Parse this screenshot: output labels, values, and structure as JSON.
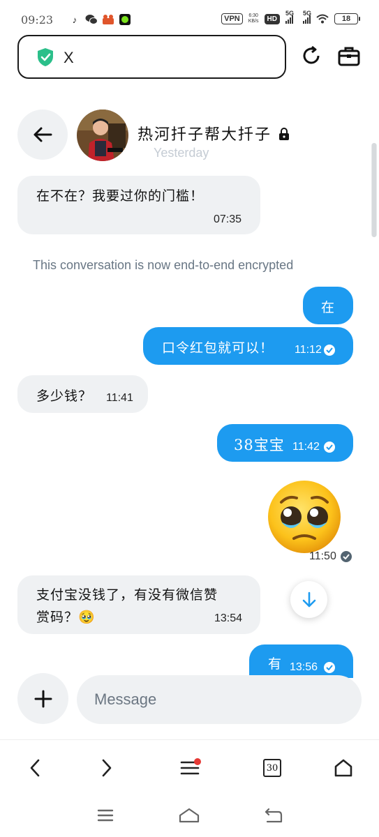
{
  "status": {
    "time": "09:23",
    "vpn": "VPN",
    "net_speed_value": "6:30",
    "net_speed_unit": "KB/s",
    "hd": "HD",
    "sig1": "5G",
    "sig2": "5G",
    "battery": "18"
  },
  "browser": {
    "url": "X",
    "tab_count": "30"
  },
  "chat": {
    "name": "热河扦子帮大扦子",
    "date_label": "Yesterday",
    "encryption_note": "This conversation is now end-to-end encrypted",
    "messages": [
      {
        "dir": "in",
        "text": "在不在？我要过你的门槛！",
        "time": "07:35"
      },
      {
        "dir": "out",
        "text": "在",
        "time": ""
      },
      {
        "dir": "out",
        "text": "口令红包就可以！",
        "time": "11:12"
      },
      {
        "dir": "in",
        "text": "多少钱？",
        "time": "11:41"
      },
      {
        "dir": "out",
        "text": "38宝宝",
        "time": "11:42"
      },
      {
        "dir": "out",
        "text": "🥹",
        "time": "11:50"
      },
      {
        "dir": "in",
        "text_line1": "支付宝没钱了，有没有微信赞",
        "text_line2": "赏码？🥹",
        "time": "13:54"
      },
      {
        "dir": "out",
        "text": "有",
        "time": "13:56"
      }
    ]
  },
  "composer": {
    "placeholder": "Message"
  },
  "colors": {
    "accent": "#1d9bf0",
    "bubble_in": "#eff1f3",
    "muted_text": "#687684",
    "notification_dot": "#e53935"
  },
  "icons": {
    "shield": "shield-check-icon",
    "refresh": "refresh-icon",
    "toolbox": "toolbox-icon",
    "back": "arrow-left-icon",
    "lock": "lock-icon",
    "check": "check-circle-icon",
    "scroll_down": "arrow-down-icon",
    "add": "plus-icon"
  }
}
